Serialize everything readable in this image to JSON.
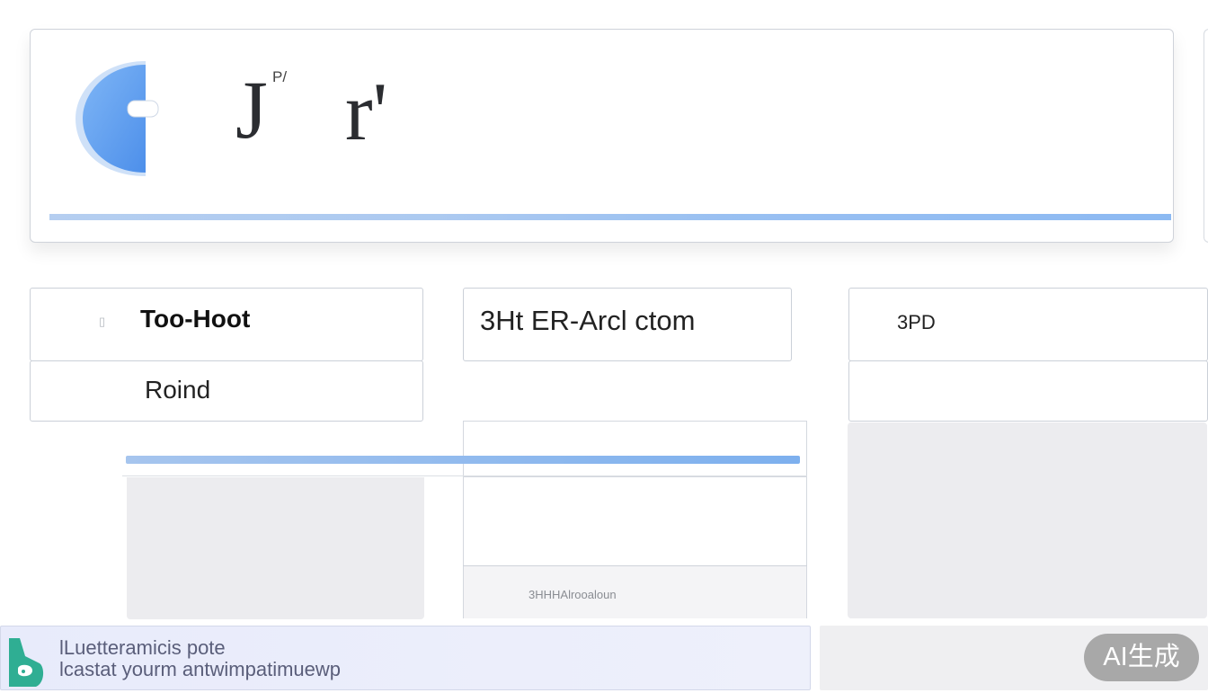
{
  "header": {
    "logo_icon": "blue-c-logo-icon",
    "glyph_left": "J",
    "glyph_superscript": "P/",
    "glyph_right": "r'"
  },
  "fields": {
    "top_left_label": "Too-Hoot",
    "top_left_icon": "document-small-icon",
    "second_left_label": "Roind",
    "top_middle_label": "3Ht ER-Arcl ctom",
    "top_right_label": "3PD"
  },
  "center_panel": {
    "footer_text": "3HHHAlrooaloun"
  },
  "bottom_bar": {
    "app_icon": "teal-app-icon",
    "line1": "lLuetteramicis pote",
    "line2": "lcastat yourm antwimpatimuewp"
  },
  "badge": {
    "label": "AI生成"
  }
}
